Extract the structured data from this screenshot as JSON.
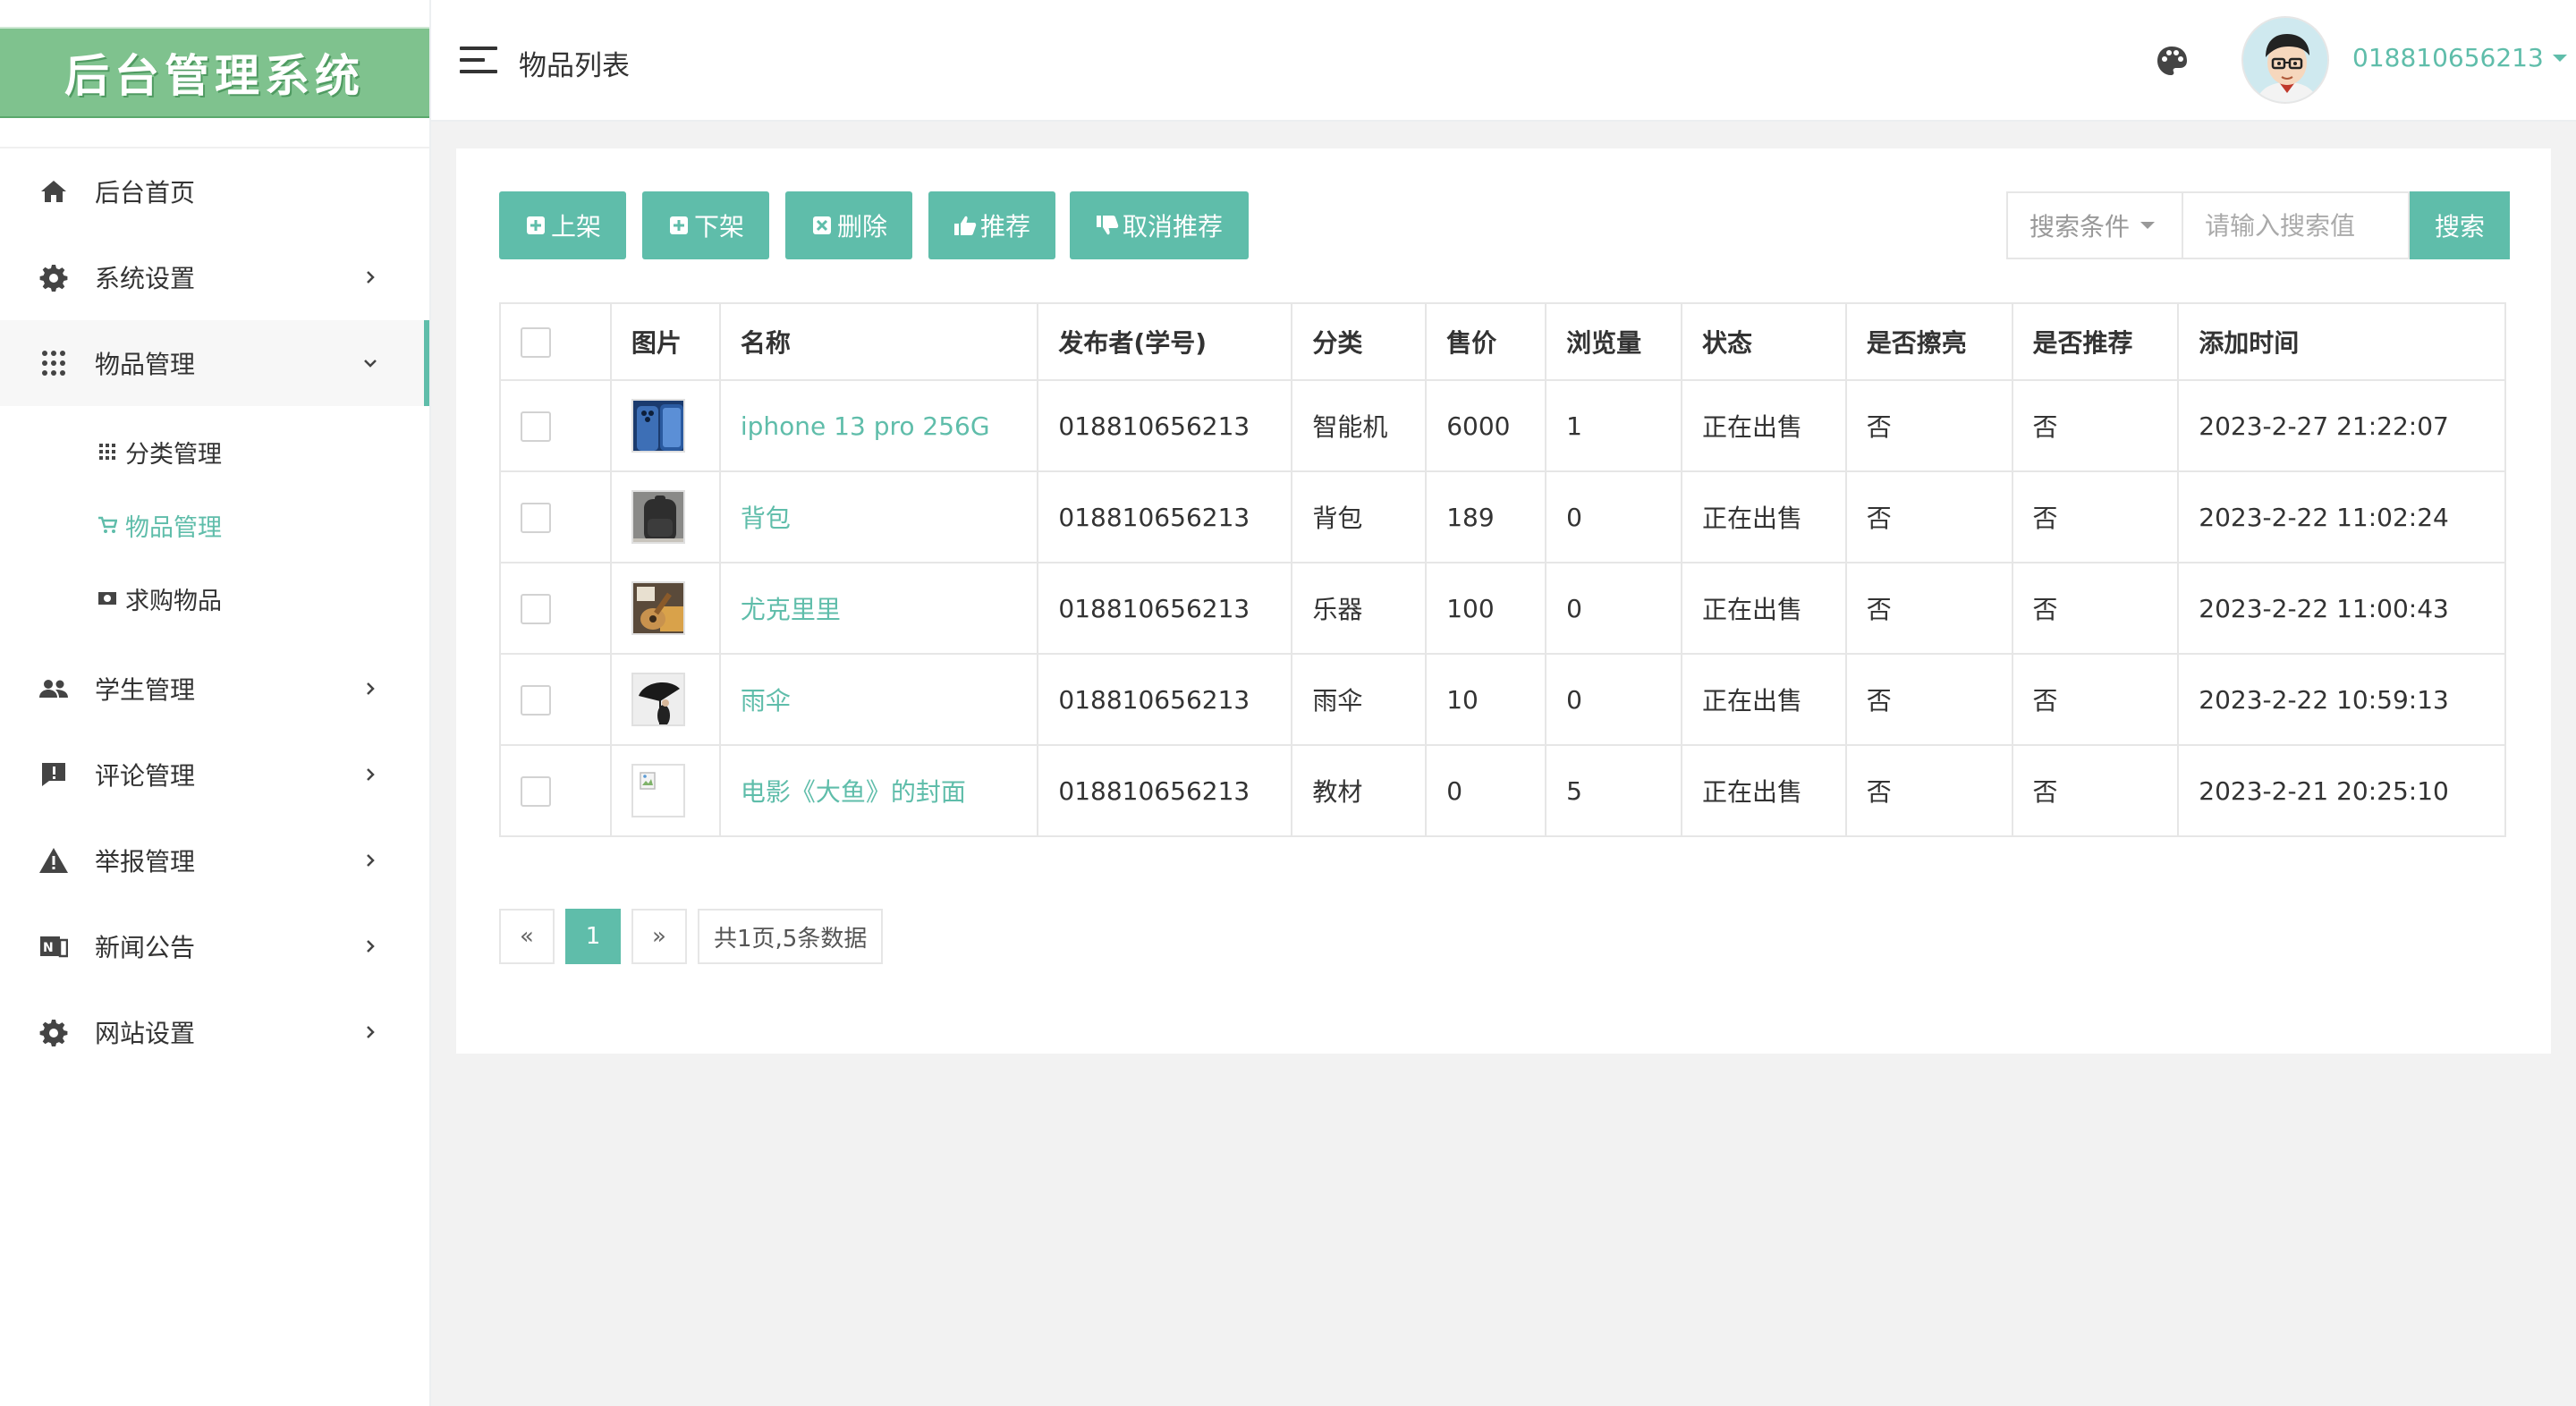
{
  "app": {
    "logo_text": "后台管理系统",
    "page_title": "物品列表",
    "user": "018810656213",
    "accent": "#5fbdaa"
  },
  "sidebar": {
    "items": [
      {
        "label": "后台首页",
        "icon": "home-icon"
      },
      {
        "label": "系统设置",
        "icon": "gear-icon"
      },
      {
        "label": "物品管理",
        "icon": "grid-icon"
      },
      {
        "label": "学生管理",
        "icon": "users-icon"
      },
      {
        "label": "评论管理",
        "icon": "comment-icon"
      },
      {
        "label": "举报管理",
        "icon": "warning-icon"
      },
      {
        "label": "新闻公告",
        "icon": "news-icon"
      },
      {
        "label": "网站设置",
        "icon": "gear-icon"
      }
    ],
    "submenu": [
      {
        "label": "分类管理",
        "icon": "grid-small-icon"
      },
      {
        "label": "物品管理",
        "icon": "cart-icon"
      },
      {
        "label": "求购物品",
        "icon": "money-icon"
      }
    ]
  },
  "toolbar": {
    "shelve": "上架",
    "unshelve": "下架",
    "delete": "删除",
    "recommend": "推荐",
    "unrecommend": "取消推荐"
  },
  "search": {
    "select_label": "搜索条件",
    "placeholder": "请输入搜索值",
    "button": "搜索"
  },
  "table": {
    "headers": [
      "图片",
      "名称",
      "发布者(学号)",
      "分类",
      "售价",
      "浏览量",
      "状态",
      "是否擦亮",
      "是否推荐",
      "添加时间"
    ],
    "rows": [
      {
        "name": "iphone 13 pro 256G",
        "publisher": "018810656213",
        "category": "智能机",
        "price": "6000",
        "views": "1",
        "status": "正在出售",
        "polished": "否",
        "recommended": "否",
        "time": "2023-2-27 21:22:07",
        "thumb": "phone"
      },
      {
        "name": "背包",
        "publisher": "018810656213",
        "category": "背包",
        "price": "189",
        "views": "0",
        "status": "正在出售",
        "polished": "否",
        "recommended": "否",
        "time": "2023-2-22 11:02:24",
        "thumb": "backpack"
      },
      {
        "name": "尤克里里",
        "publisher": "018810656213",
        "category": "乐器",
        "price": "100",
        "views": "0",
        "status": "正在出售",
        "polished": "否",
        "recommended": "否",
        "time": "2023-2-22 11:00:43",
        "thumb": "ukulele"
      },
      {
        "name": "雨伞",
        "publisher": "018810656213",
        "category": "雨伞",
        "price": "10",
        "views": "0",
        "status": "正在出售",
        "polished": "否",
        "recommended": "否",
        "time": "2023-2-22 10:59:13",
        "thumb": "umbrella"
      },
      {
        "name": "电影《大鱼》的封面",
        "publisher": "018810656213",
        "category": "教材",
        "price": "0",
        "views": "5",
        "status": "正在出售",
        "polished": "否",
        "recommended": "否",
        "time": "2023-2-21 20:25:10",
        "thumb": "broken"
      }
    ]
  },
  "pagination": {
    "prev": "«",
    "current": "1",
    "next": "»",
    "total": "共1页,5条数据"
  }
}
